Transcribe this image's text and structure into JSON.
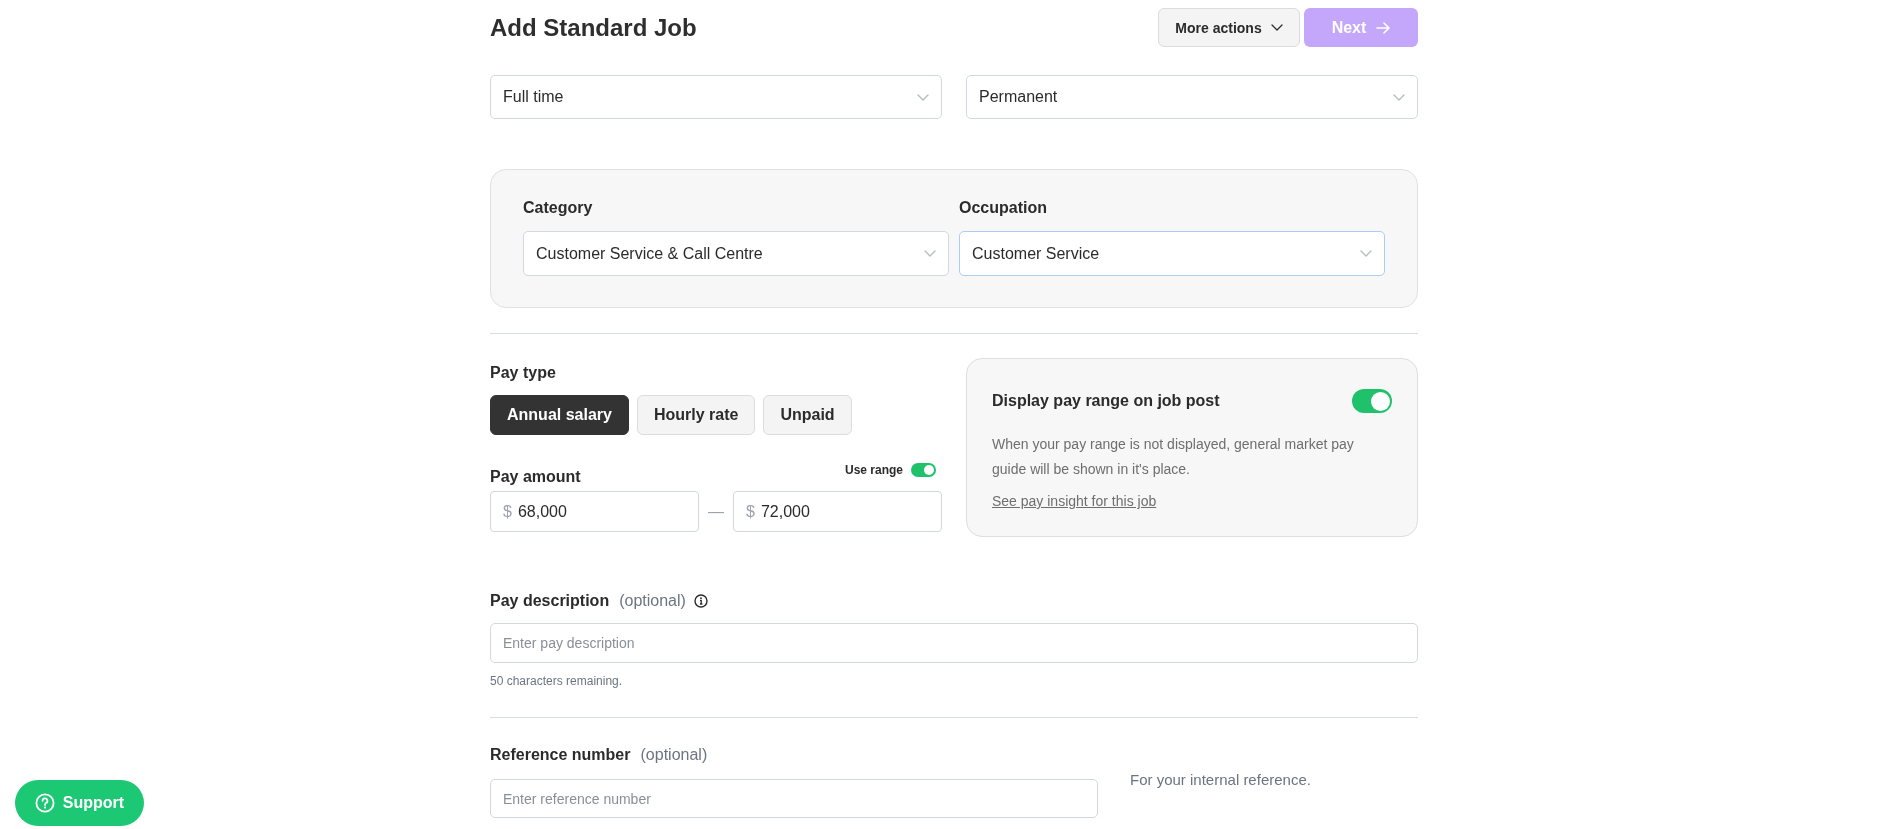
{
  "page_header": {
    "title": "Add Standard Job",
    "actions": [
      {
        "kind": "menu",
        "label": "More actions",
        "disabled": false
      },
      {
        "kind": "next",
        "label": "Next",
        "disabled": true
      }
    ]
  },
  "job_type_selects": [
    {
      "value": "Full time",
      "focused": false
    },
    {
      "value": "Permanent",
      "focused": false
    }
  ],
  "classification": [
    {
      "label": "Category",
      "value": "Customer Service & Call Centre",
      "focused": false
    },
    {
      "label": "Occupation",
      "value": "Customer Service",
      "focused": true
    }
  ],
  "pay_type": {
    "label": "Pay type",
    "options": [
      {
        "label": "Annual salary",
        "selected": true
      },
      {
        "label": "Hourly rate",
        "selected": false
      },
      {
        "label": "Unpaid",
        "selected": false
      }
    ]
  },
  "pay_amount": {
    "label": "Pay amount",
    "range_toggle": {
      "label": "Use range",
      "on": true
    },
    "fields": [
      {
        "prefix": "$",
        "value": "68,000"
      },
      {
        "prefix": "$",
        "value": "72,000"
      }
    ],
    "separator": "—"
  },
  "pay_display": {
    "title": "Display pay range on job post",
    "on": true,
    "description": "When your pay range is not displayed, general market pay guide will be shown in it's place.",
    "link": "See pay insight for this job"
  },
  "pay_description": {
    "label": "Pay description",
    "optional": "(optional)",
    "placeholder": "Enter pay description",
    "helper": "50 characters remaining."
  },
  "reference_number": {
    "label": "Reference number",
    "optional": "(optional)",
    "placeholder": "Enter reference number",
    "note": "For your internal reference."
  },
  "support_button": {
    "label": "Support"
  }
}
